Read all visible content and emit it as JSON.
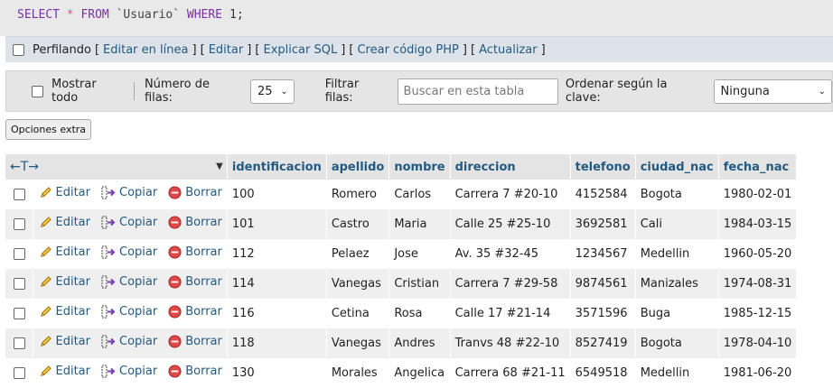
{
  "query": {
    "select": "SELECT",
    "star": "*",
    "from": "FROM",
    "table": "`Usuario`",
    "where": "WHERE",
    "cond": "1",
    "end": ";"
  },
  "links_bar": {
    "profiling_label": "Perfilando",
    "edit_inline": "Editar en línea",
    "edit": "Editar",
    "explain_sql": "Explicar SQL",
    "create_php": "Crear código PHP",
    "refresh": "Actualizar",
    "bracket_open": "[",
    "bracket_close": "]",
    "sep": "] ["
  },
  "nav": {
    "show_all": "Mostrar todo",
    "rows_label": "Número de filas:",
    "rows_value": "25",
    "filter_label": "Filtrar filas:",
    "filter_placeholder": "Buscar en esta tabla",
    "order_label": "Ordenar según la clave:",
    "order_value": "Ninguna"
  },
  "extra_options": "Opciones extra",
  "table": {
    "col_arrows": "←T→",
    "columns": [
      "identificacion",
      "apellido",
      "nombre",
      "direccion",
      "telefono",
      "ciudad_nac",
      "fecha_nac"
    ],
    "actions": {
      "edit": "Editar",
      "copy": "Copiar",
      "delete": "Borrar"
    },
    "rows": [
      [
        "100",
        "Romero",
        "Carlos",
        "Carrera 7 #20-10",
        "4152584",
        "Bogota",
        "1980-02-01"
      ],
      [
        "101",
        "Castro",
        "Maria",
        "Calle 25 #25-10",
        "3692581",
        "Cali",
        "1984-03-15"
      ],
      [
        "112",
        "Pelaez",
        "Jose",
        "Av. 35 #32-45",
        "1234567",
        "Medellin",
        "1960-05-20"
      ],
      [
        "114",
        "Vanegas",
        "Cristian",
        "Carrera 7 #29-58",
        "9874561",
        "Manizales",
        "1974-08-31"
      ],
      [
        "116",
        "Cetina",
        "Rosa",
        "Calle 17 #21-14",
        "3571596",
        "Buga",
        "1985-12-15"
      ],
      [
        "118",
        "Vanegas",
        "Andres",
        "Tranvs 48 #22-10",
        "8527419",
        "Bogota",
        "1978-04-10"
      ],
      [
        "130",
        "Morales",
        "Angelica",
        "Carrera 68 #21-11",
        "6549518",
        "Medellin",
        "1981-06-20"
      ]
    ]
  }
}
